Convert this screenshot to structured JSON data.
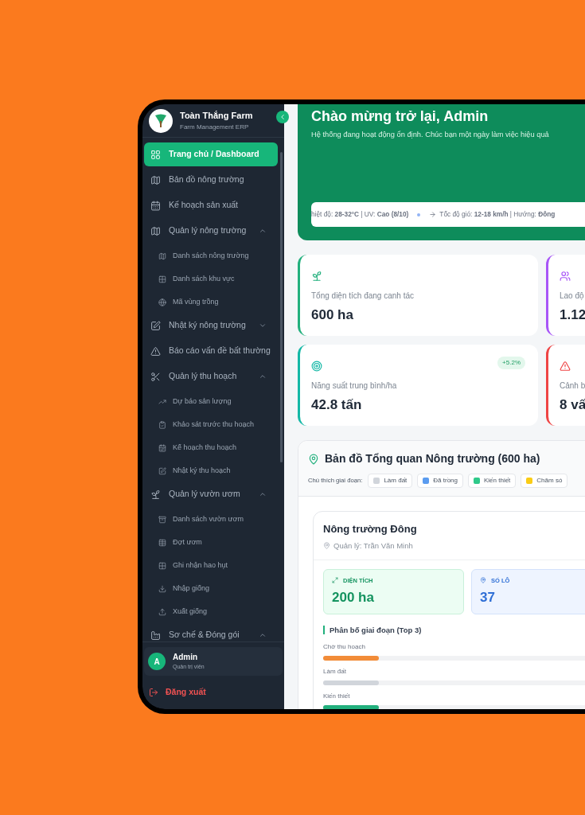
{
  "sidebar": {
    "brand": {
      "name": "Toàn Thắng Farm",
      "subtitle": "Farm Management ERP"
    },
    "nav": [
      {
        "label": "Trang chủ / Dashboard",
        "kind": "link",
        "selected": true
      },
      {
        "label": "Bản đồ nông trường",
        "kind": "link",
        "selected": false
      },
      {
        "label": "Kế hoạch sản xuất",
        "kind": "link",
        "selected": false
      },
      {
        "label": "Quản lý nông trường",
        "kind": "group",
        "selected": false,
        "expanded": true,
        "children": [
          {
            "label": "Danh sách nông trường",
            "selected": false
          },
          {
            "label": "Danh sách khu vực",
            "selected": false
          },
          {
            "label": "Mã vùng trồng",
            "selected": false
          }
        ]
      },
      {
        "label": "Nhật ký nông trường",
        "kind": "group",
        "selected": false,
        "expanded": false
      },
      {
        "label": "Báo cáo vấn đề bất thường",
        "kind": "link",
        "selected": false
      },
      {
        "label": "Quản lý thu hoạch",
        "kind": "group",
        "selected": false,
        "expanded": true,
        "children": [
          {
            "label": "Dự báo sản lượng",
            "selected": false
          },
          {
            "label": "Khảo sát trước thu hoạch",
            "selected": false
          },
          {
            "label": "Kế hoạch thu hoạch",
            "selected": false
          },
          {
            "label": "Nhật ký thu hoạch",
            "selected": false
          }
        ]
      },
      {
        "label": "Quản lý vườn ươm",
        "kind": "group",
        "selected": false,
        "expanded": true,
        "children": [
          {
            "label": "Danh sách vườn ươm",
            "selected": false
          },
          {
            "label": "Đợt ươm",
            "selected": false
          },
          {
            "label": "Ghi nhận hao hụt",
            "selected": false
          },
          {
            "label": "Nhập giống",
            "selected": false
          },
          {
            "label": "Xuất giống",
            "selected": false
          }
        ]
      },
      {
        "label": "Sơ chế & Đóng gói",
        "kind": "group",
        "selected": false,
        "expanded": true
      }
    ],
    "user": {
      "initial": "A",
      "name": "Admin",
      "role": "Quản trị viên"
    },
    "logout": "Đăng xuất"
  },
  "hero": {
    "title": "Chào mừng trở lại, Admin",
    "subtitle": "Hệ thống đang hoạt động ổn định. Chúc bạn một ngày làm việc hiệu quả",
    "weather": {
      "temperature": "hiệt độ: **28-32°C** | UV: **Cao (8/10)**",
      "wind": "Tốc độ gió: **12-18 km/h** | Hướng: **Đông**"
    }
  },
  "stats": [
    {
      "label": "Tổng diện tích đang canh tác",
      "value": "600 ha",
      "color": "#22b07d"
    },
    {
      "label": "Lao độ",
      "value": "1.12",
      "color": "#a855f7"
    },
    {
      "label": "Năng suất trung bình/ha",
      "value": "42.8 tấn",
      "color": "#14b8a6",
      "badge": "+5.2%"
    },
    {
      "label": "Cảnh b",
      "value": "8 vấ",
      "color": "#ef4444"
    }
  ],
  "map": {
    "title": "Bản đồ Tổng quan Nông trường (600 ha)",
    "legend_label": "Chú thích giai đoạn:",
    "legend": [
      {
        "label": "Làm đất",
        "color": "#d1d5db"
      },
      {
        "label": "Đã trồng",
        "color": "#5b9cf0"
      },
      {
        "label": "Kiến thiết",
        "color": "#2fc98a"
      },
      {
        "label": "Chăm só",
        "color": "#facc15"
      }
    ],
    "farm": {
      "name": "Nông trường Đông",
      "manager": "Quản lý: Trần Văn Minh",
      "metrics": [
        {
          "label": "DIỆN TÍCH",
          "value": "200 ha",
          "kind": "area"
        },
        {
          "label": "SỐ LÔ",
          "value": "37",
          "kind": "plots"
        }
      ],
      "distribution_title": "Phân bố giai đoạn (Top 3)",
      "stages": [
        {
          "label": "Chờ thu hoạch",
          "level": 0.2,
          "color": "#f28c38"
        },
        {
          "label": "Làm đất",
          "level": 0.2,
          "color": "#d1d5db"
        },
        {
          "label": "Kiến thiết",
          "level": 0.2,
          "color": "#22b07d"
        }
      ]
    }
  }
}
